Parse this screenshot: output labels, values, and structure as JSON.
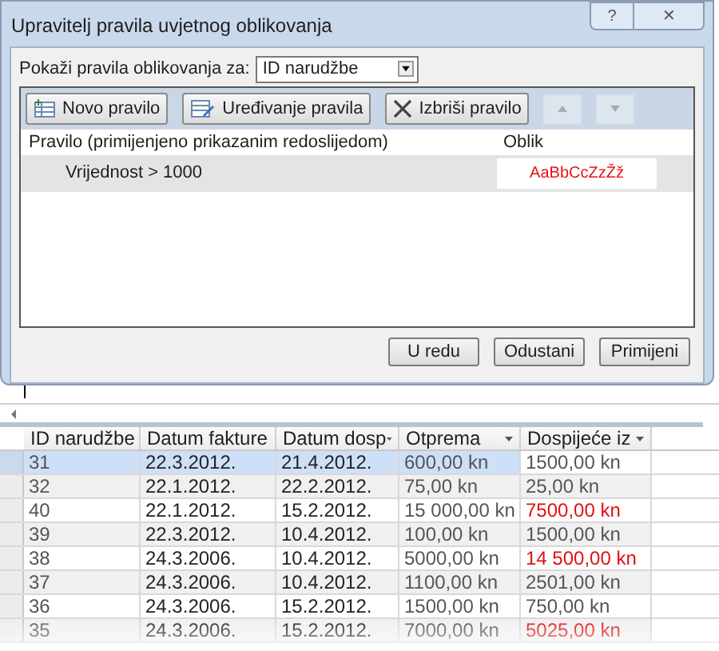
{
  "window": {
    "title": "Upravitelj pravila uvjetnog oblikovanja",
    "help": "?",
    "close": "✕"
  },
  "show_rules": {
    "label": "Pokaži pravila oblikovanja za:",
    "value": "ID narudžbe"
  },
  "toolbar": [
    {
      "kind": "new",
      "label": "Novo pravilo",
      "disabled": false
    },
    {
      "kind": "edit",
      "label": "Uređivanje pravila",
      "disabled": false
    },
    {
      "kind": "delete",
      "label": "Izbriši pravilo",
      "disabled": false
    },
    {
      "kind": "up",
      "disabled": true
    },
    {
      "kind": "down",
      "disabled": true
    }
  ],
  "rules_table": {
    "columns": [
      "Pravilo (primijenjeno prikazanim redoslijedom)",
      "Oblik"
    ],
    "rows": [
      {
        "rule": "Vrijednost > 1000",
        "preview": "AaBbCcZzŽž",
        "selected": true
      }
    ]
  },
  "buttons": [
    "U redu",
    "Odustani",
    "Primijeni"
  ],
  "datasheet": {
    "columns": [
      "ID narudžbe",
      "Datum fakture",
      "Datum dosp",
      "Otprema",
      "Dospijeće iz"
    ],
    "rows": [
      {
        "cells": [
          "31",
          "22.3.2012.",
          "21.4.2012.",
          "600,00 kn",
          "1500,00 kn"
        ],
        "selected": true,
        "flagged": false
      },
      {
        "cells": [
          "32",
          "22.1.2012.",
          "22.2.2012.",
          "75,00 kn",
          "25,00 kn"
        ],
        "selected": false,
        "flagged": false
      },
      {
        "cells": [
          "40",
          "22.1.2012.",
          "15.2.2012.",
          "15 000,00 kn",
          "7500,00 kn"
        ],
        "selected": false,
        "flagged": true
      },
      {
        "cells": [
          "39",
          "22.3.2012.",
          "10.4.2012.",
          "100,00 kn",
          "1500,00 kn"
        ],
        "selected": false,
        "flagged": false
      },
      {
        "cells": [
          "38",
          "24.3.2006.",
          "10.4.2012.",
          "5000,00 kn",
          "14 500,00 kn"
        ],
        "selected": false,
        "flagged": true
      },
      {
        "cells": [
          "37",
          "24.3.2006.",
          "10.4.2012.",
          "1100,00 kn",
          "2501,00 kn"
        ],
        "selected": false,
        "flagged": false
      },
      {
        "cells": [
          "36",
          "24.3.2006.",
          "15.2.2012.",
          "1500,00 kn",
          "750,00 kn"
        ],
        "selected": false,
        "flagged": false
      },
      {
        "cells": [
          "35",
          "24.3.2006.",
          "15.2.2012.",
          "7000,00 kn",
          "5025,00 kn"
        ],
        "selected": false,
        "flagged": true
      }
    ]
  }
}
